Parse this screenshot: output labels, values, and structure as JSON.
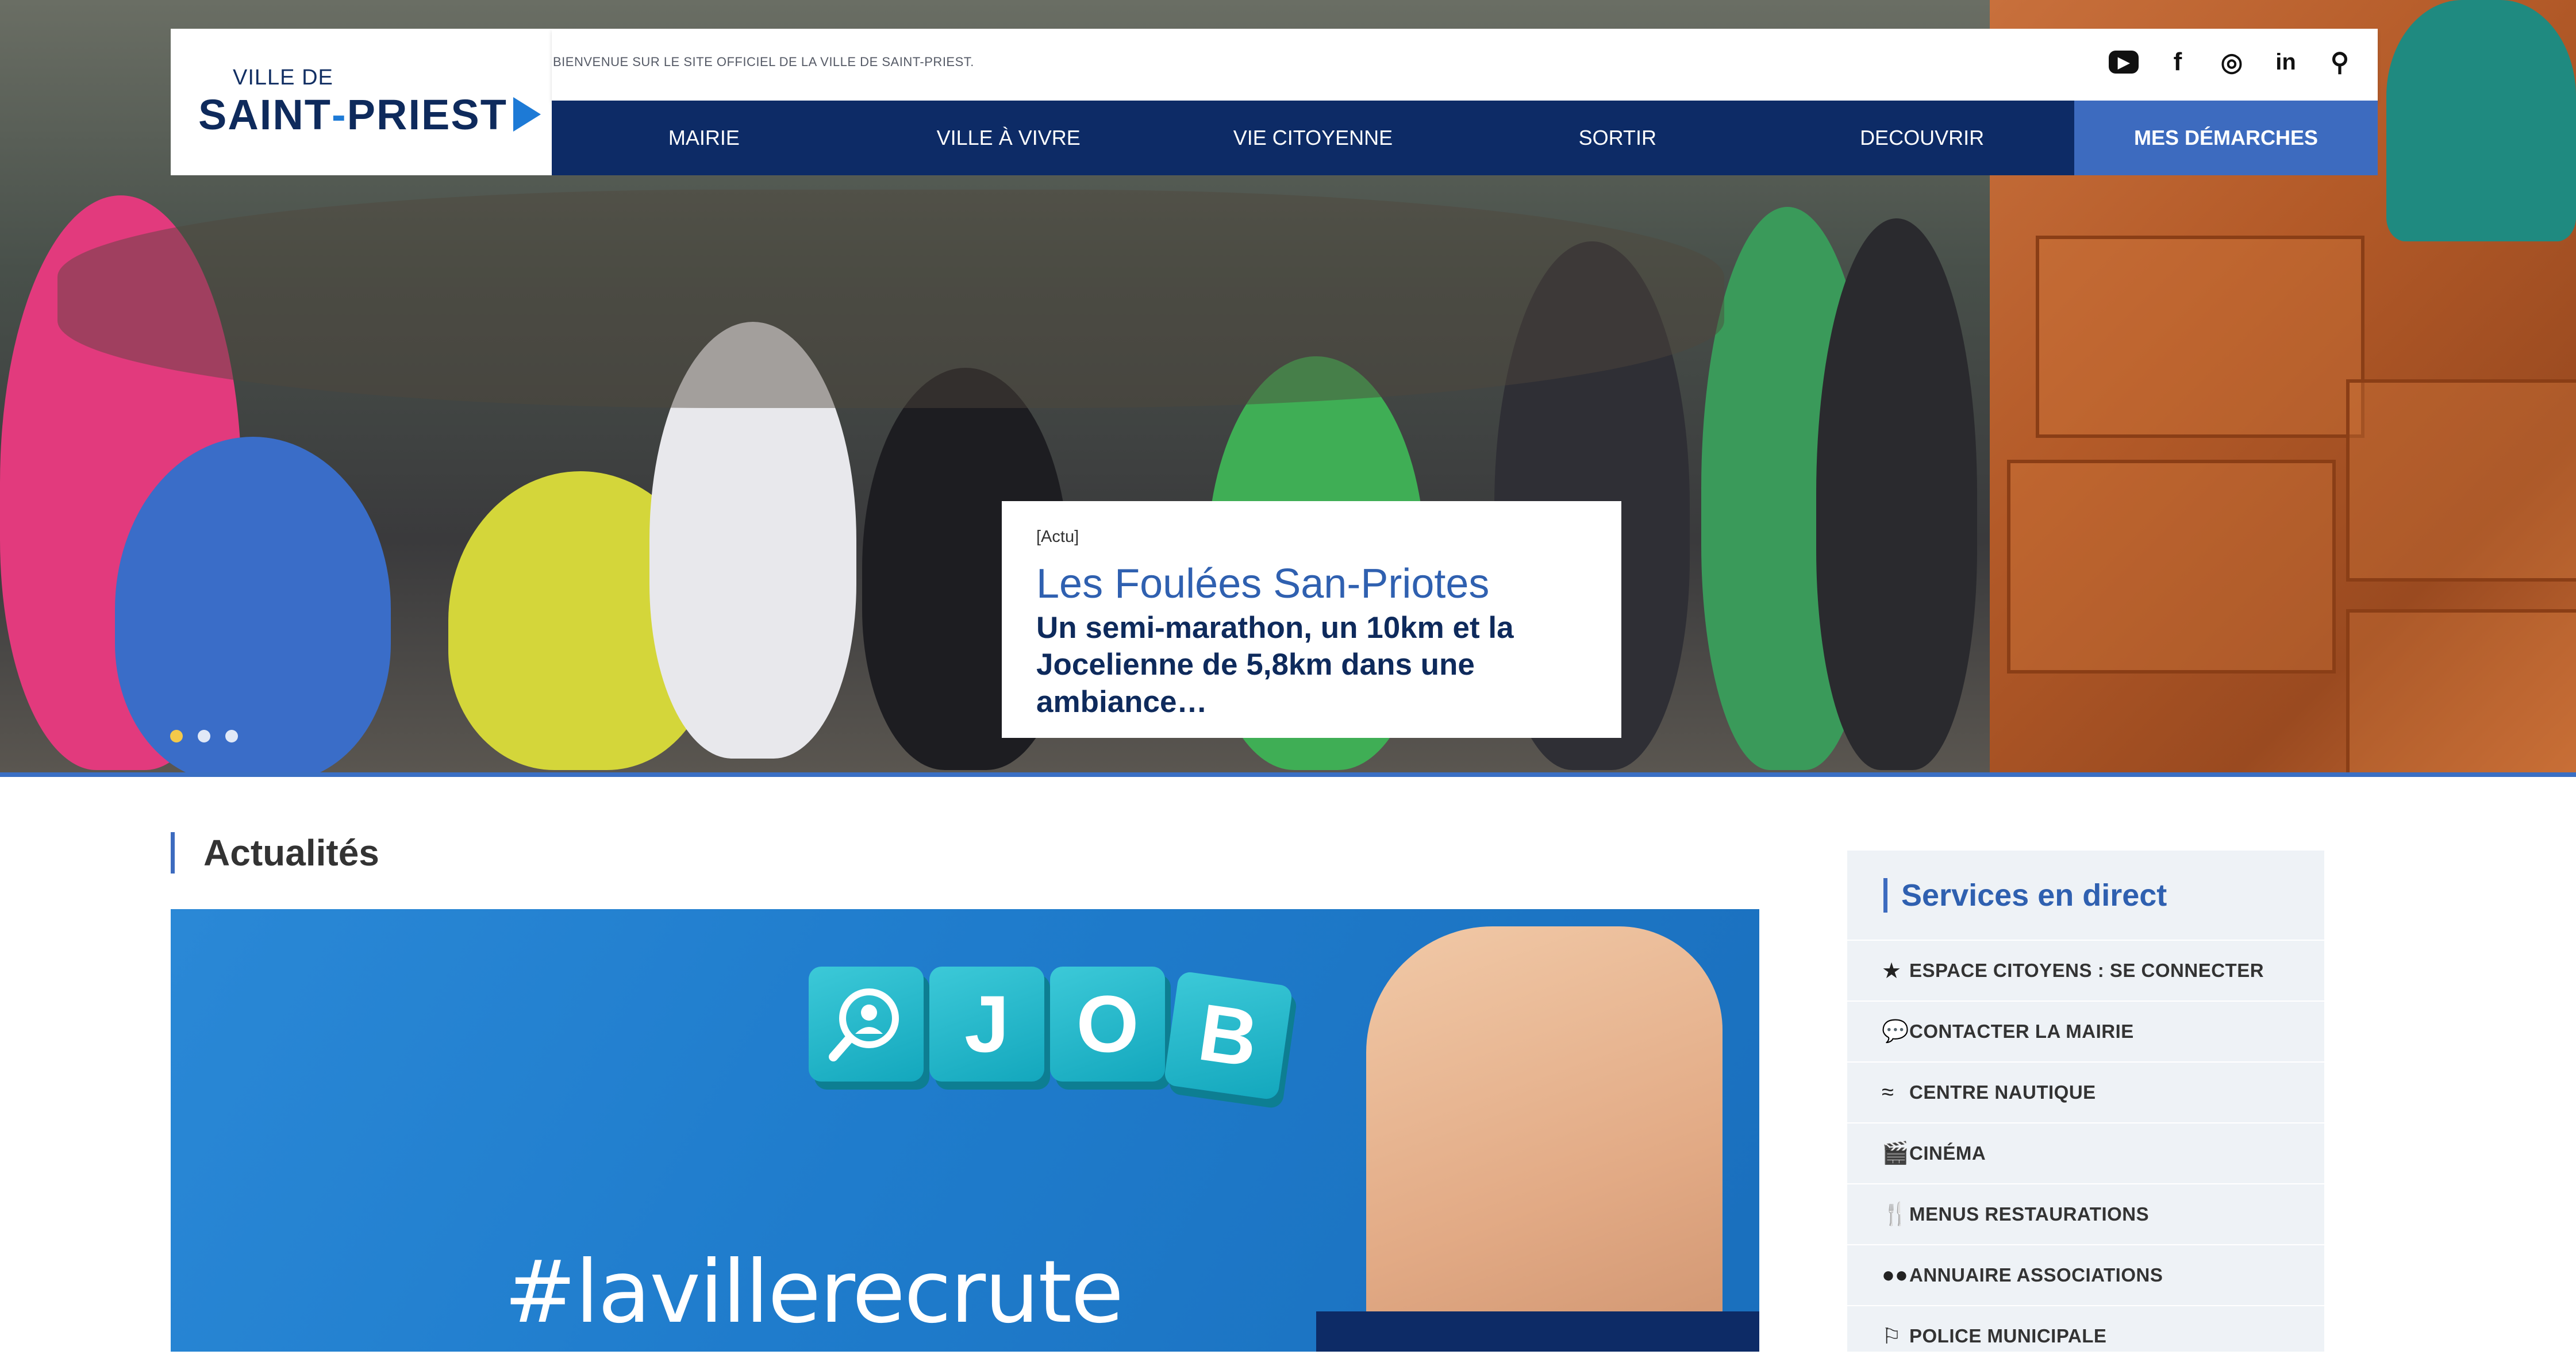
{
  "header": {
    "logo_small": "VILLE DE",
    "logo_main_a": "SAINT",
    "logo_main_dash": "-",
    "logo_main_b": "PRIEST",
    "welcome": "BIENVENUE SUR LE SITE OFFICIEL DE LA VILLE DE SAINT-PRIEST."
  },
  "socials": [
    {
      "icon": "youtube-icon",
      "glyph": "▶"
    },
    {
      "icon": "facebook-icon",
      "glyph": "f"
    },
    {
      "icon": "instagram-icon",
      "glyph": "◎"
    },
    {
      "icon": "linkedin-icon",
      "glyph": "in"
    },
    {
      "icon": "search-icon",
      "glyph": "⚲"
    }
  ],
  "nav": {
    "items": [
      "MAIRIE",
      "VILLE À VIVRE",
      "VIE CITOYENNE",
      "SORTIR",
      "DECOUVRIR"
    ],
    "special": "MES DÉMARCHES"
  },
  "hero": {
    "tag": "[Actu]",
    "title": "Les Foulées San-Priotes",
    "description": "Un semi-marathon, un 10km et la Jocelienne de 5,8km dans une ambiance…",
    "slides": 3,
    "active_slide": 1
  },
  "actualites": {
    "heading": "Actualités",
    "cubes": [
      "",
      "J",
      "O",
      "B"
    ],
    "hashtag": "#lavillerecrute"
  },
  "services": {
    "title": "Services en direct",
    "items": [
      {
        "label": "ESPACE CITOYENS : SE CONNECTER",
        "icon": "star-icon",
        "glyph": "★"
      },
      {
        "label": "CONTACTER LA MAIRIE",
        "icon": "speech-bubble-icon",
        "glyph": "💬"
      },
      {
        "label": "CENTRE NAUTIQUE",
        "icon": "swimmer-icon",
        "glyph": "≈"
      },
      {
        "label": "CINÉMA",
        "icon": "clapperboard-icon",
        "glyph": "🎬"
      },
      {
        "label": "MENUS RESTAURATIONS",
        "icon": "cutlery-icon",
        "glyph": "🍴"
      },
      {
        "label": "ANNUAIRE ASSOCIATIONS",
        "icon": "people-icon",
        "glyph": "●●"
      },
      {
        "label": "POLICE MUNICIPALE",
        "icon": "police-icon",
        "glyph": "⚐"
      }
    ]
  },
  "colors": {
    "navy": "#0d2b66",
    "accent_blue": "#3d6bbf",
    "title_blue": "#2f60b0",
    "dot_active": "#f3c94a"
  }
}
